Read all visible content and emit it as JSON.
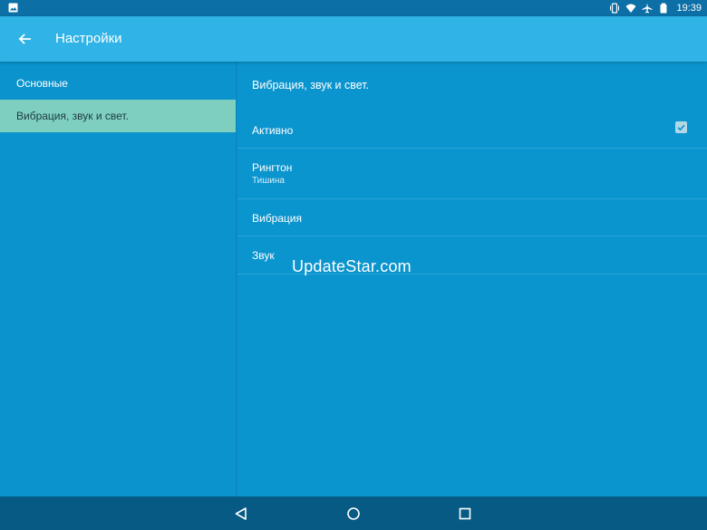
{
  "status_bar": {
    "time": "19:39",
    "icons": [
      "image-notification-icon",
      "vibrate-icon",
      "wifi-icon",
      "airplane-icon",
      "battery-icon"
    ]
  },
  "app_bar": {
    "title": "Настройки",
    "back_icon": "arrow-back-icon",
    "color": "#30b3e6"
  },
  "sidebar": {
    "items": [
      {
        "label": "Основные",
        "active": false
      },
      {
        "label": "Вибрация, звук и свет.",
        "active": true
      }
    ],
    "active_color": "#7fcfc0"
  },
  "detail": {
    "section_title": "Вибрация, звук и свет.",
    "prefs": [
      {
        "title": "Активно",
        "summary": "",
        "checked": true
      },
      {
        "title": "Рингтон",
        "summary": "Тишина"
      },
      {
        "title": "Вибрация",
        "summary": ""
      },
      {
        "title": "Звук",
        "summary": ""
      }
    ]
  },
  "watermark": "UpdateStar.com",
  "nav_bar": {
    "buttons": [
      "back-triangle-icon",
      "home-circle-icon",
      "recents-square-icon"
    ]
  },
  "colors": {
    "background": "#0a93cc",
    "status_bar": "#0c6fa6",
    "nav_bar": "#075a84"
  }
}
